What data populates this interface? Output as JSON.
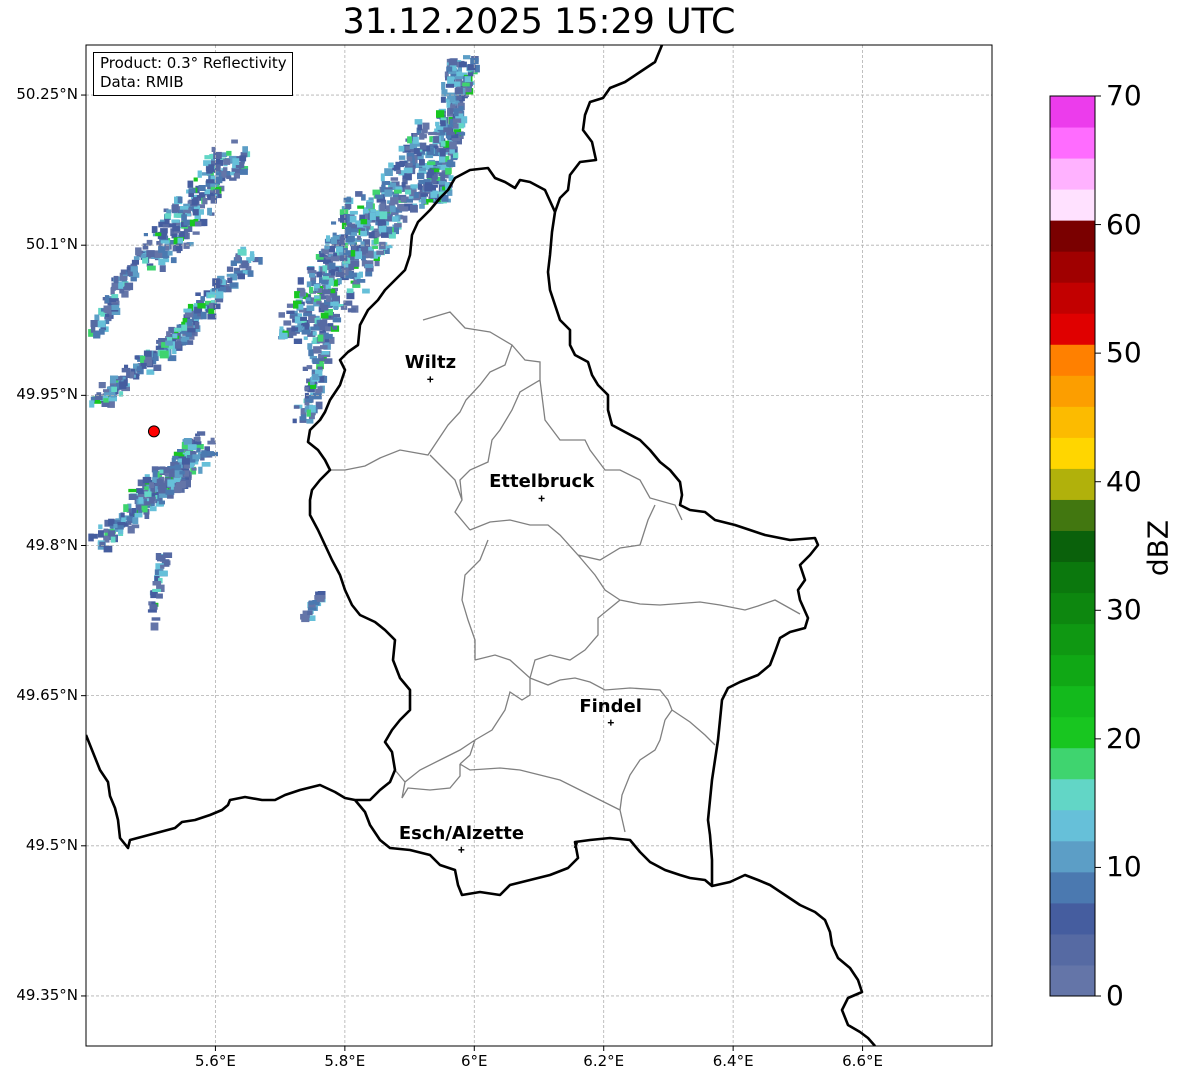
{
  "title": "31.12.2025 15:29 UTC",
  "info": {
    "product": "Product: 0.3° Reflectivity",
    "data": "Data: RMIB"
  },
  "axes": {
    "lat_labels": [
      "50.25°N",
      "50.1°N",
      "49.95°N",
      "49.8°N",
      "49.65°N",
      "49.5°N",
      "49.35°N"
    ],
    "lon_labels": [
      "5.6°E",
      "5.8°E",
      "6°E",
      "6.2°E",
      "6.4°E",
      "6.6°E"
    ],
    "lat_range": [
      49.3,
      50.3
    ],
    "lon_range": [
      5.4,
      6.8
    ],
    "grid": true
  },
  "cities": [
    {
      "name": "Wiltz",
      "lon": 5.932,
      "lat": 49.966
    },
    {
      "name": "Ettelbruck",
      "lon": 6.104,
      "lat": 49.847
    },
    {
      "name": "Findel",
      "lon": 6.211,
      "lat": 49.623
    },
    {
      "name": "Esch/Alzette",
      "lon": 5.98,
      "lat": 49.496
    }
  ],
  "radar_site": {
    "lon": 5.505,
    "lat": 49.914,
    "color": "#ff0000"
  },
  "colorbar": {
    "label": "dBZ",
    "ticks": [
      "0",
      "10",
      "20",
      "30",
      "40",
      "50",
      "60",
      "70"
    ],
    "min": 0,
    "max": 70,
    "colors": [
      "#6475a8",
      "#566aa3",
      "#455d9f",
      "#4b79b0",
      "#5c9ec6",
      "#66c0d9",
      "#62d6c6",
      "#3fd46f",
      "#18c620",
      "#13ba1c",
      "#10a815",
      "#0f9812",
      "#0d870f",
      "#0b780d",
      "#0a610b",
      "#427710",
      "#b1b10b",
      "#ffd600",
      "#fcbb00",
      "#fc9e00",
      "#ff8000",
      "#e00000",
      "#c20000",
      "#a00000",
      "#7a0000",
      "#ffe1ff",
      "#ffb2ff",
      "#ff6cff",
      "#ec3cec"
    ]
  }
}
